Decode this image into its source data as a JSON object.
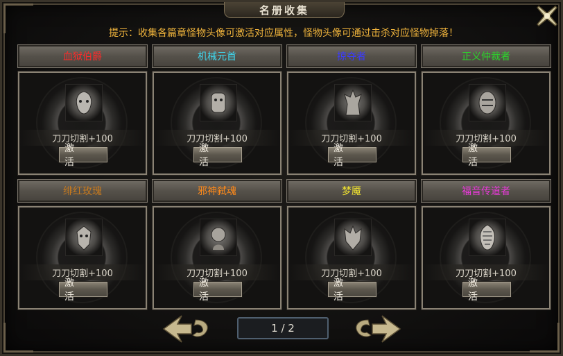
{
  "window": {
    "title": "名册收集"
  },
  "hint": "提示：收集各篇章怪物头像可激活对应属性，怪物头像可通过击杀对应怪物掉落！",
  "cards": [
    {
      "name": "血狱伯爵",
      "name_color": "#ff2a2a",
      "attr": "刀刀切割+100",
      "button": "激 活",
      "icon": "monster-portrait-icon"
    },
    {
      "name": "机械元首",
      "name_color": "#3fd8f0",
      "attr": "刀刀切割+100",
      "button": "激 活",
      "icon": "monster-portrait-icon"
    },
    {
      "name": "掠夺者",
      "name_color": "#3b3bff",
      "attr": "刀刀切割+100",
      "button": "激 活",
      "icon": "monster-portrait-icon"
    },
    {
      "name": "正义仲裁者",
      "name_color": "#2bd62b",
      "attr": "刀刀切割+100",
      "button": "激 活",
      "icon": "monster-portrait-icon"
    },
    {
      "name": "绯红玫瑰",
      "name_color": "#c87a1e",
      "attr": "刀刀切割+100",
      "button": "激 活",
      "icon": "monster-portrait-icon"
    },
    {
      "name": "邪神弑魂",
      "name_color": "#ff8a1a",
      "attr": "刀刀切割+100",
      "button": "激 活",
      "icon": "monster-portrait-icon"
    },
    {
      "name": "梦魇",
      "name_color": "#f2e430",
      "attr": "刀刀切割+100",
      "button": "激 活",
      "icon": "monster-portrait-icon"
    },
    {
      "name": "福音传道者",
      "name_color": "#e83ad8",
      "attr": "刀刀切割+100",
      "button": "激 活",
      "icon": "monster-portrait-icon"
    }
  ],
  "pager": {
    "text": "1 / 2",
    "current": 1,
    "total": 2
  },
  "icons": {
    "prev": "arrow-left-icon",
    "next": "arrow-right-icon",
    "close": "close-icon"
  }
}
